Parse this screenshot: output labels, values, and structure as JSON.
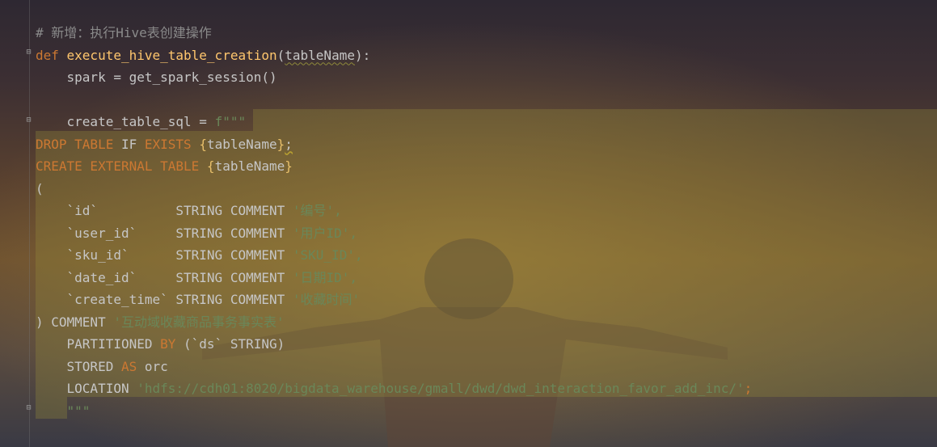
{
  "editor": {
    "lines": [
      [
        {
          "t": "# 新增：执行Hive表创建操作",
          "c": "cm"
        }
      ],
      [
        {
          "t": "def ",
          "c": "kw"
        },
        {
          "t": "execute_hive_table_creation",
          "c": "fn"
        },
        {
          "t": "(",
          "c": ""
        },
        {
          "t": "tableName",
          "c": "param"
        },
        {
          "t": "):",
          "c": ""
        }
      ],
      [
        {
          "t": "    spark = get_spark_session()",
          "c": ""
        }
      ],
      [
        {
          "t": "",
          "c": ""
        }
      ],
      [
        {
          "t": "    create_table_sql = ",
          "c": ""
        },
        {
          "t": "f\"\"\"",
          "c": "str"
        }
      ],
      [
        {
          "t": "DROP TABLE ",
          "c": "kw"
        },
        {
          "t": "IF ",
          "c": ""
        },
        {
          "t": "EXISTS ",
          "c": "kw"
        },
        {
          "t": "{",
          "c": "br"
        },
        {
          "t": "tableName",
          "c": ""
        },
        {
          "t": "}",
          "c": "br"
        },
        {
          "t": ";",
          "c": "warn"
        }
      ],
      [
        {
          "t": "CREATE EXTERNAL TABLE ",
          "c": "kw"
        },
        {
          "t": "{",
          "c": "br"
        },
        {
          "t": "tableName",
          "c": ""
        },
        {
          "t": "}",
          "c": "br"
        }
      ],
      [
        {
          "t": "(",
          "c": ""
        }
      ],
      [
        {
          "t": "    `id`          STRING COMMENT ",
          "c": ""
        },
        {
          "t": "'编号',",
          "c": "str"
        }
      ],
      [
        {
          "t": "    `user_id`     STRING COMMENT ",
          "c": ""
        },
        {
          "t": "'用户ID',",
          "c": "str"
        }
      ],
      [
        {
          "t": "    `sku_id`      STRING COMMENT ",
          "c": ""
        },
        {
          "t": "'SKU_ID',",
          "c": "str"
        }
      ],
      [
        {
          "t": "    `date_id`     STRING COMMENT ",
          "c": ""
        },
        {
          "t": "'日期ID',",
          "c": "str"
        }
      ],
      [
        {
          "t": "    `create_time` STRING COMMENT ",
          "c": ""
        },
        {
          "t": "'收藏时间'",
          "c": "str"
        }
      ],
      [
        {
          "t": ") COMMENT ",
          "c": ""
        },
        {
          "t": "'互动域收藏商品事务事实表'",
          "c": "str"
        }
      ],
      [
        {
          "t": "    PARTITIONED ",
          "c": ""
        },
        {
          "t": "BY ",
          "c": "kw"
        },
        {
          "t": "(`ds` STRING)",
          "c": ""
        }
      ],
      [
        {
          "t": "    STORED ",
          "c": ""
        },
        {
          "t": "AS ",
          "c": "kw"
        },
        {
          "t": "orc",
          "c": ""
        }
      ],
      [
        {
          "t": "    LOCATION ",
          "c": ""
        },
        {
          "t": "'hdfs://cdh01:8020/bigdata_warehouse/gmall/dwd/dwd_interaction_favor_add_inc/'",
          "c": "str"
        },
        {
          "t": ";",
          "c": "kw"
        }
      ],
      [
        {
          "t": "    ",
          "c": ""
        },
        {
          "t": "\"\"\"",
          "c": "str"
        }
      ]
    ]
  }
}
